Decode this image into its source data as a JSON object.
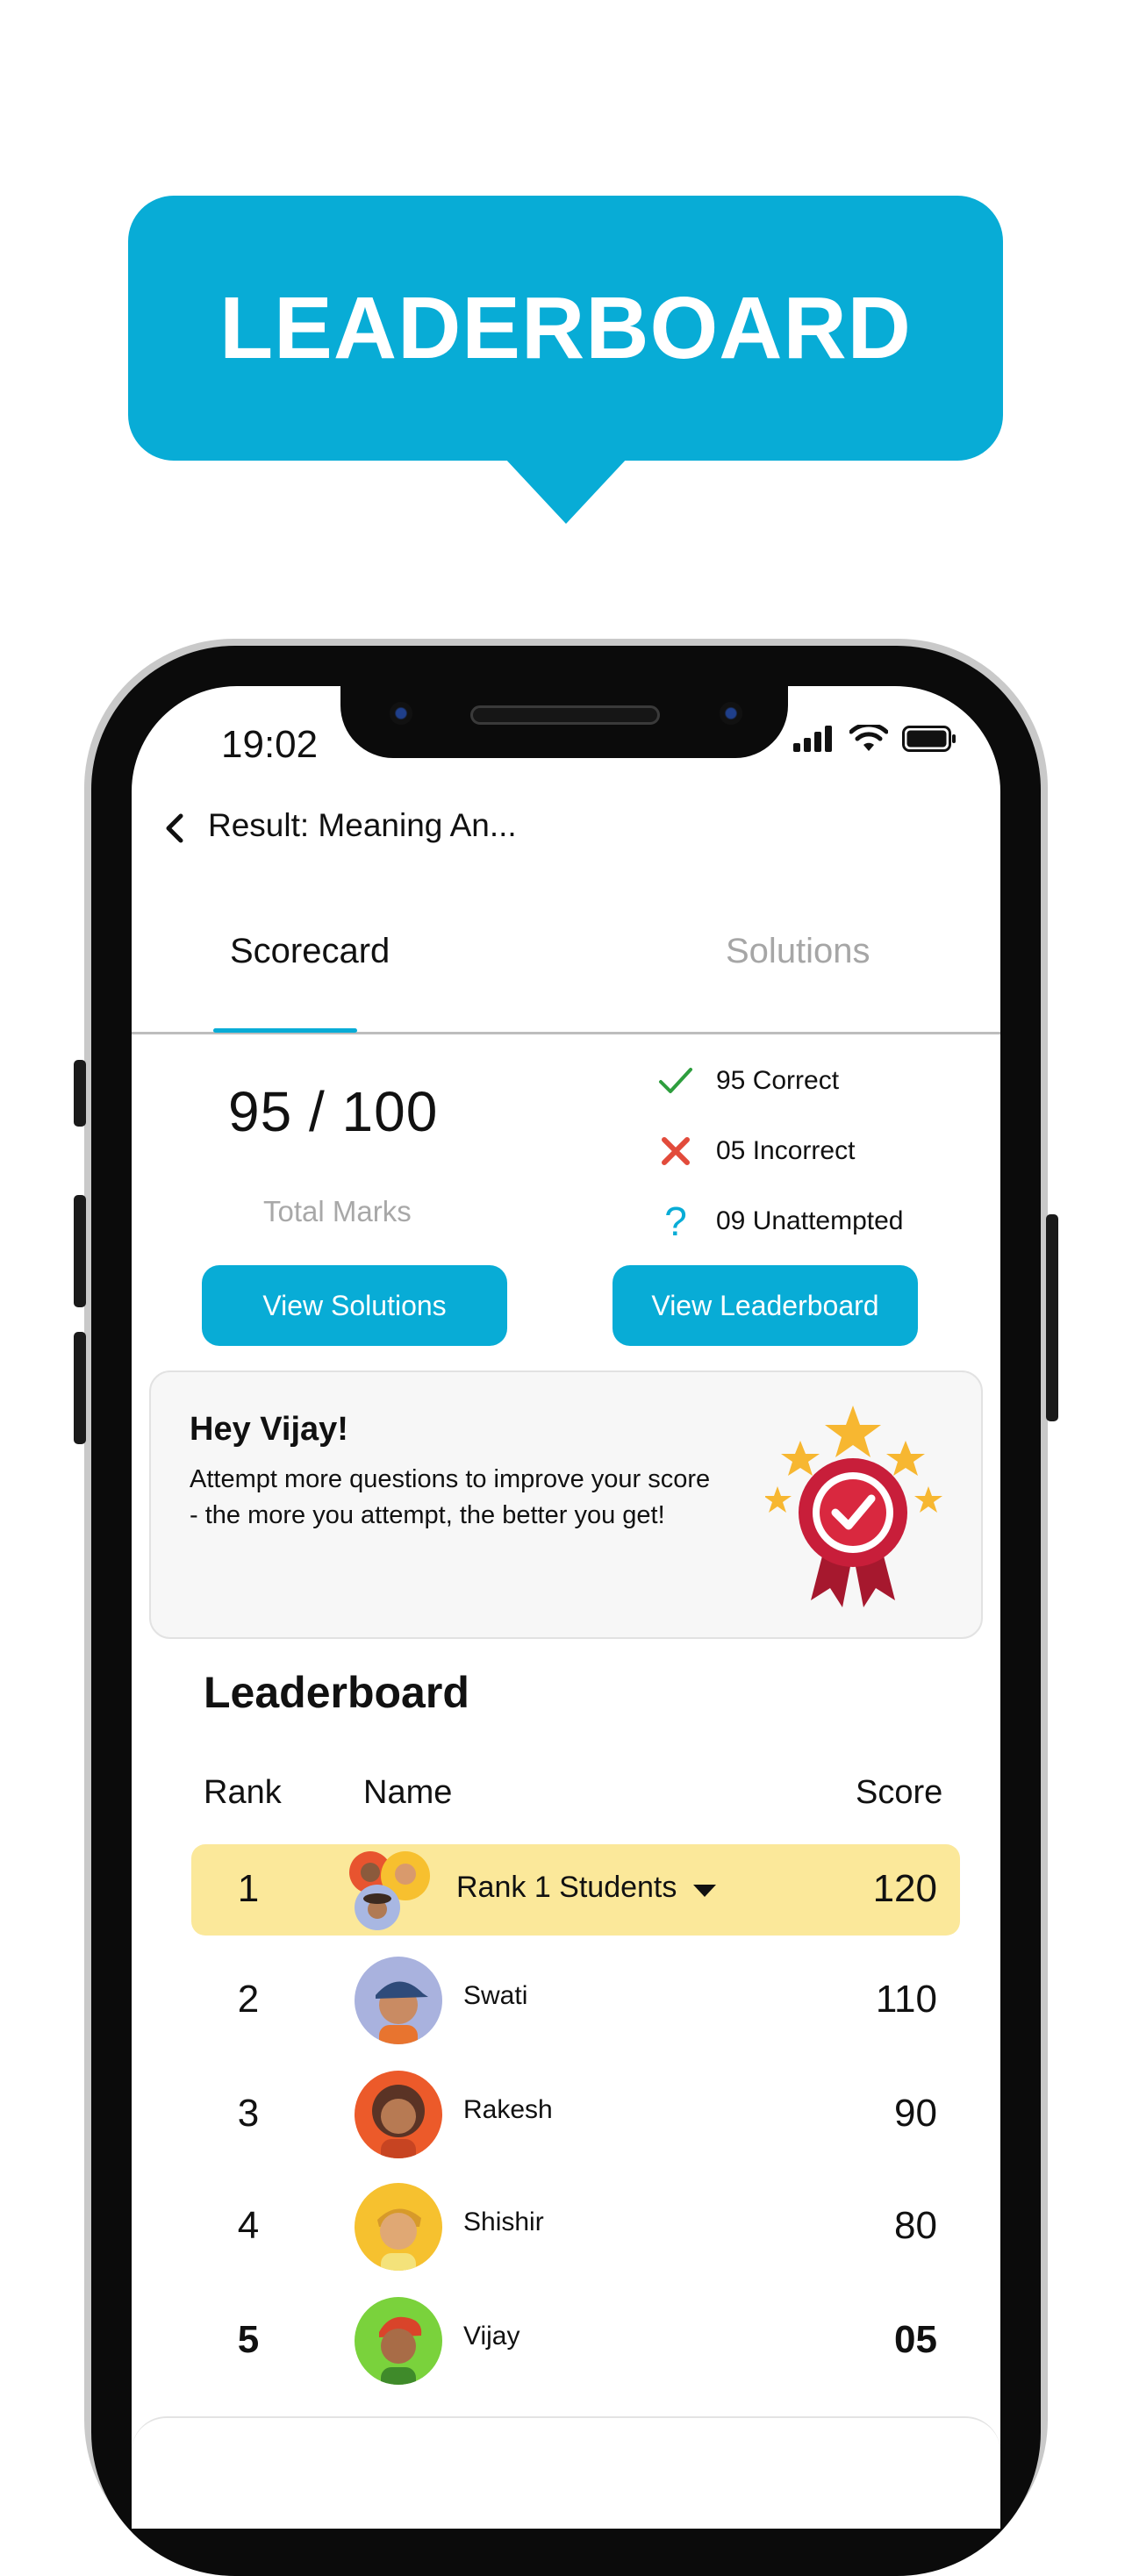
{
  "banner": {
    "title": "LEADERBOARD"
  },
  "status_bar": {
    "time": "19:02"
  },
  "header": {
    "title": "Result: Meaning An..."
  },
  "tabs": [
    {
      "label": "Scorecard"
    },
    {
      "label": "Solutions"
    }
  ],
  "score": {
    "value": "95 / 100",
    "label": "Total Marks"
  },
  "stats": [
    {
      "icon": "check-icon",
      "text": "95 Correct",
      "color": "#2e9e3e"
    },
    {
      "icon": "cross-icon",
      "text": "05 Incorrect",
      "color": "#e24b3b"
    },
    {
      "icon": "question-icon",
      "text": "09 Unattempted",
      "color": "#08acd6"
    }
  ],
  "buttons": {
    "view_solutions": "View Solutions",
    "view_leaderboard": "View Leaderboard"
  },
  "motivation": {
    "title": "Hey Vijay!",
    "text": "Attempt more questions to improve your score - the more you attempt, the better you get!"
  },
  "leaderboard": {
    "title": "Leaderboard",
    "columns": {
      "rank": "Rank",
      "name": "Name",
      "score": "Score"
    },
    "rows": [
      {
        "rank": "1",
        "name": "Rank 1 Students",
        "score": "120"
      },
      {
        "rank": "2",
        "name": "Swati",
        "score": "110"
      },
      {
        "rank": "3",
        "name": "Rakesh",
        "score": "90"
      },
      {
        "rank": "4",
        "name": "Shishir",
        "score": "80"
      },
      {
        "rank": "5",
        "name": "Vijay",
        "score": "05"
      }
    ]
  },
  "colors": {
    "accent": "#08acd6",
    "highlight_row": "#fbe89a"
  }
}
